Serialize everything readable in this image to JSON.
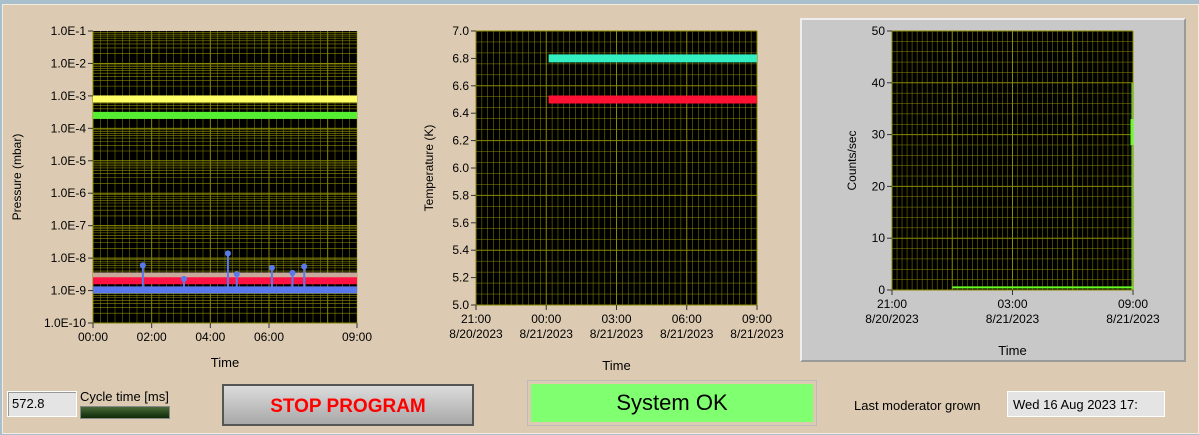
{
  "status": {
    "cycle_value": "572.8",
    "cycle_label": "Cycle time [ms]",
    "cycle_progress": 0.0,
    "stop_label": "STOP PROGRAM",
    "system_status": "System OK",
    "last_moderator_label": "Last moderator grown",
    "last_moderator_value": "Wed 16 Aug 2023 17:"
  },
  "colors": {
    "panel": "#dccbb2",
    "plot_bg": "#000000",
    "grid": "#8a8a00",
    "status_ok": "#80ff70",
    "stop_text": "#ff0000"
  },
  "chart_data": [
    {
      "type": "line",
      "title": "",
      "xlabel": "Time",
      "ylabel": "Pressure (mbar)",
      "yscale": "log",
      "ylim_exp": [
        -10,
        -1
      ],
      "y_ticks": [
        "1.0E-1",
        "1.0E-2",
        "1.0E-3",
        "1.0E-4",
        "1.0E-5",
        "1.0E-6",
        "1.0E-7",
        "1.0E-8",
        "1.0E-9",
        "1.0E-10"
      ],
      "x_range_hours": [
        0,
        9
      ],
      "x_ticks": [
        {
          "h": 0,
          "label": "00:00"
        },
        {
          "h": 2,
          "label": "02:00"
        },
        {
          "h": 4,
          "label": "04:00"
        },
        {
          "h": 6,
          "label": "06:00"
        },
        {
          "h": 9,
          "label": "09:00"
        }
      ],
      "series": [
        {
          "name": "yellow",
          "color": "#ffff66",
          "value": 0.0008,
          "x": [
            0,
            9
          ]
        },
        {
          "name": "green",
          "color": "#55ee33",
          "value": 0.00025,
          "x": [
            0,
            9
          ]
        },
        {
          "name": "tan",
          "color": "#c8aa9a",
          "value": 2.8e-09,
          "x": [
            0,
            9
          ]
        },
        {
          "name": "red",
          "color": "#ff1144",
          "value": 2e-09,
          "x": [
            0,
            9
          ]
        },
        {
          "name": "blue",
          "color": "#5a78ee",
          "value": 1.05e-09,
          "x": [
            0,
            9
          ],
          "spikes": [
            [
              1.7,
              6e-09
            ],
            [
              3.1,
              2.3e-09
            ],
            [
              4.6,
              1.4e-08
            ],
            [
              4.9,
              3.2e-09
            ],
            [
              6.1,
              5e-09
            ],
            [
              6.8,
              3.5e-09
            ],
            [
              7.2,
              5.5e-09
            ]
          ]
        }
      ]
    },
    {
      "type": "line",
      "title": "",
      "xlabel": "Time",
      "ylabel": "Temperature (K)",
      "ylim": [
        5.0,
        7.0
      ],
      "y_ticks": [
        "7.0",
        "6.8",
        "6.6",
        "6.4",
        "6.2",
        "6.0",
        "5.8",
        "5.6",
        "5.4",
        "5.2",
        "5.0"
      ],
      "x_range_hours": [
        0,
        12
      ],
      "x_ticks": [
        {
          "h": 0,
          "label": "21:00",
          "date": "8/20/2023"
        },
        {
          "h": 3,
          "label": "00:00",
          "date": "8/21/2023"
        },
        {
          "h": 6,
          "label": "03:00",
          "date": "8/21/2023"
        },
        {
          "h": 9,
          "label": "06:00",
          "date": "8/21/2023"
        },
        {
          "h": 12,
          "label": "09:00",
          "date": "8/21/2023"
        }
      ],
      "series": [
        {
          "name": "cyan",
          "color": "#33eec0",
          "value": 6.8,
          "x": [
            3.1,
            12
          ]
        },
        {
          "name": "red",
          "color": "#ff1133",
          "value": 6.5,
          "x": [
            3.1,
            12
          ]
        }
      ]
    },
    {
      "type": "line",
      "title": "",
      "xlabel": "Time",
      "ylabel": "Counts/sec",
      "ylim": [
        0,
        50
      ],
      "y_ticks": [
        "50",
        "40",
        "30",
        "20",
        "10",
        "0"
      ],
      "x_range_hours": [
        0,
        12
      ],
      "x_ticks": [
        {
          "h": 0,
          "label": "21:00",
          "date": "8/20/2023"
        },
        {
          "h": 6,
          "label": "03:00",
          "date": "8/21/2023"
        },
        {
          "h": 12,
          "label": "09:00",
          "date": "8/21/2023"
        }
      ],
      "series": [
        {
          "name": "counts",
          "color": "#66ff22",
          "value": 0.5,
          "x": [
            3,
            12
          ],
          "end_spike": [
            28,
            33
          ]
        }
      ]
    }
  ]
}
